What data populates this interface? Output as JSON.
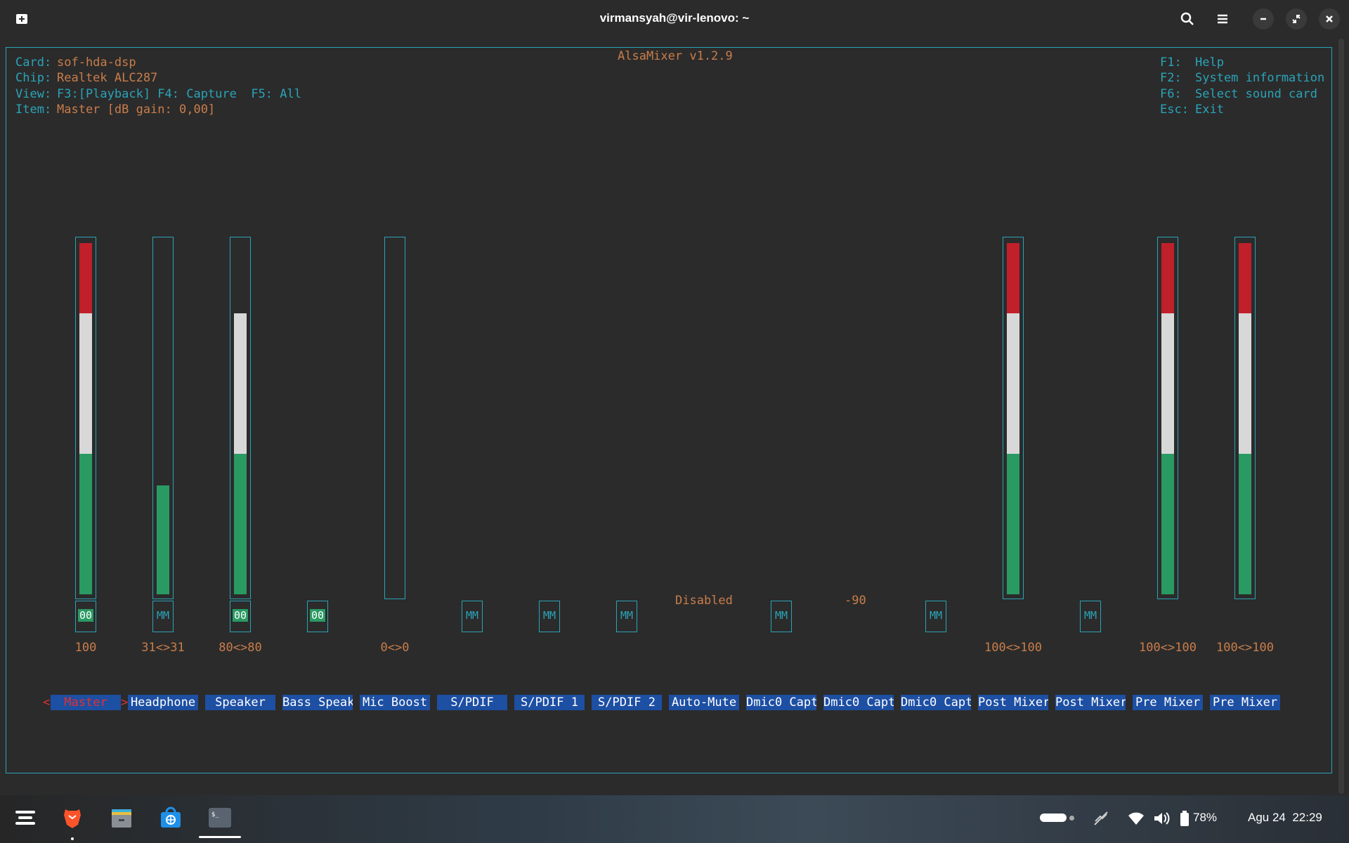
{
  "window": {
    "title": "virmansyah@vir-lenovo: ~"
  },
  "mixer": {
    "title": "AlsaMixer v1.2.9",
    "card_label": "Card:",
    "card_value": "sof-hda-dsp",
    "chip_label": "Chip:",
    "chip_value": "Realtek ALC287",
    "view_label": "View:",
    "view_value": "F3:[Playback] F4: Capture  F5: All",
    "item_label": "Item:",
    "item_value": "Master [dB gain: 0,00]",
    "help": [
      {
        "key": "F1:",
        "text": "Help"
      },
      {
        "key": "F2:",
        "text": "System information"
      },
      {
        "key": "F6:",
        "text": "Select sound card"
      },
      {
        "key": "Esc:",
        "text": "Exit"
      }
    ],
    "disabled_text": "Disabled",
    "dmic_value": "-90",
    "channels": [
      {
        "label": "Master",
        "value": "100",
        "level": 1.0,
        "mute": "00"
      },
      {
        "label": "Headphone",
        "value": "31<>31",
        "level": 0.31,
        "mute": "MM"
      },
      {
        "label": "Speaker",
        "value": "80<>80",
        "level": 0.8,
        "mute": "00"
      },
      {
        "label": "Bass Speak",
        "value": "",
        "level": null,
        "mute": "00"
      },
      {
        "label": "Mic Boost",
        "value": "0<>0",
        "level": 0.0,
        "mute": ""
      },
      {
        "label": "S/PDIF",
        "value": "",
        "level": null,
        "mute": "MM"
      },
      {
        "label": "S/PDIF 1",
        "value": "",
        "level": null,
        "mute": "MM"
      },
      {
        "label": "S/PDIF 2",
        "value": "",
        "level": null,
        "mute": "MM"
      },
      {
        "label": "Auto-Mute",
        "value": "",
        "level": null,
        "mute": ""
      },
      {
        "label": "Dmic0 Capt",
        "value": "",
        "level": null,
        "mute": "MM"
      },
      {
        "label": "Dmic0 Capt",
        "value": "",
        "level": null,
        "mute": ""
      },
      {
        "label": "Dmic0 Capt",
        "value": "",
        "level": null,
        "mute": "MM"
      },
      {
        "label": "Post Mixer",
        "value": "100<>100",
        "level": 1.0,
        "mute": ""
      },
      {
        "label": "Post Mixer",
        "value": "",
        "level": null,
        "mute": "MM"
      },
      {
        "label": "Pre Mixer",
        "value": "100<>100",
        "level": 1.0,
        "mute": ""
      },
      {
        "label": "Pre Mixer",
        "value": "100<>100",
        "level": 1.0,
        "mute": ""
      }
    ]
  },
  "taskbar": {
    "battery": "78%",
    "datetime": "Agu 24  22:29",
    "apps": [
      "zorin-menu-icon",
      "brave-browser-icon",
      "files-icon",
      "software-store-icon",
      "terminal-icon"
    ]
  },
  "colors": {
    "accent": "#2aa3b8",
    "text_orange": "#c97d4a",
    "green": "#2a9a63",
    "red": "#c0202a",
    "white": "#d8d8d8"
  }
}
